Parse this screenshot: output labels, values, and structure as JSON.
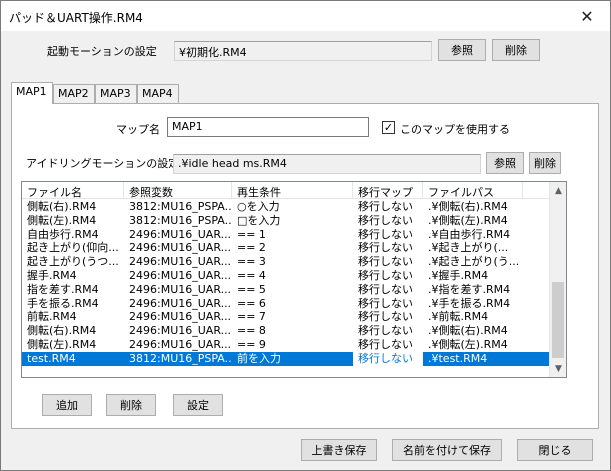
{
  "window": {
    "title": "パッド＆UART操作.RM4",
    "close_glyph": "✕"
  },
  "startup": {
    "label": "起動モーションの設定",
    "value": "¥初期化.RM4",
    "browse_label": "参照",
    "delete_label": "削除"
  },
  "tabs": [
    {
      "label": "MAP1"
    },
    {
      "label": "MAP2"
    },
    {
      "label": "MAP3"
    },
    {
      "label": "MAP4"
    }
  ],
  "map": {
    "name_label": "マップ名",
    "name_value": "MAP1",
    "use_checkbox_label": "このマップを使用する",
    "use_checked": true,
    "check_glyph": "✓"
  },
  "idling": {
    "label": "アイドリングモーションの設定",
    "value": ".¥idle head ms.RM4",
    "browse_label": "参照",
    "delete_label": "削除"
  },
  "list": {
    "columns": [
      "ファイル名",
      "参照変数",
      "再生条件",
      "移行マップ",
      "ファイルパス"
    ],
    "rows": [
      [
        "側転(右).RM4",
        "3812:MU16_PSPA...",
        "○を入力",
        "移行しない",
        ".¥側転(右).RM4"
      ],
      [
        "側転(左).RM4",
        "3812:MU16_PSPA...",
        "□を入力",
        "移行しない",
        ".¥側転(左).RM4"
      ],
      [
        "自由歩行.RM4",
        "2496:MU16_UAR...",
        "== 1",
        "移行しない",
        ".¥自由歩行.RM4"
      ],
      [
        "起き上がり(仰向...",
        "2496:MU16_UAR...",
        "== 2",
        "移行しない",
        ".¥起き上がり(..."
      ],
      [
        "起き上がり(うつ...",
        "2496:MU16_UAR...",
        "== 3",
        "移行しない",
        ".¥起き上がり(う..."
      ],
      [
        "握手.RM4",
        "2496:MU16_UAR...",
        "== 4",
        "移行しない",
        ".¥握手.RM4"
      ],
      [
        "指を差す.RM4",
        "2496:MU16_UAR...",
        "== 5",
        "移行しない",
        ".¥指を差す.RM4"
      ],
      [
        "手を振る.RM4",
        "2496:MU16_UAR...",
        "== 6",
        "移行しない",
        ".¥手を振る.RM4"
      ],
      [
        "前転.RM4",
        "2496:MU16_UAR...",
        "== 7",
        "移行しない",
        ".¥前転.RM4"
      ],
      [
        "側転(右).RM4",
        "2496:MU16_UAR...",
        "== 8",
        "移行しない",
        ".¥側転(右).RM4"
      ],
      [
        "側転(左).RM4",
        "2496:MU16_UAR...",
        "== 9",
        "移行しない",
        ".¥側転(左).RM4"
      ],
      [
        "test.RM4",
        "3812:MU16_PSPA...",
        "前を入力",
        "移行しない",
        ".¥test.RM4"
      ]
    ],
    "selected_index": 11,
    "scroll_up_glyph": "▲",
    "scroll_down_glyph": "▼"
  },
  "list_buttons": {
    "add_label": "追加",
    "delete_label": "削除",
    "settings_label": "設定"
  },
  "footer": {
    "overwrite_save_label": "上書き保存",
    "save_as_label": "名前を付けて保存",
    "close_label": "閉じる"
  },
  "colors": {
    "selection": "#0078d7",
    "dialog_bg": "#f0f0f0"
  }
}
